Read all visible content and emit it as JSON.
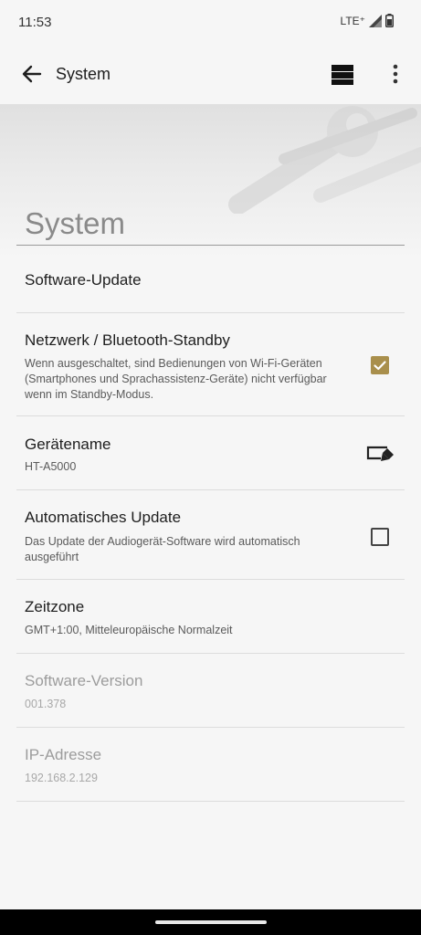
{
  "status_bar": {
    "time": "11:53",
    "network": "LTE⁺",
    "icons": [
      "signal-icon",
      "battery-icon"
    ]
  },
  "app_bar": {
    "title": "System",
    "icons": [
      "back-arrow-icon",
      "grid-view-icon",
      "more-vert-icon"
    ]
  },
  "hero": {
    "title": "System"
  },
  "settings": {
    "software_update": {
      "title": "Software-Update"
    },
    "network_standby": {
      "title": "Netzwerk / Bluetooth-Standby",
      "subtitle": "Wenn ausgeschaltet, sind Bedienungen von Wi-Fi-Geräten (Smartphones und Sprachassistenz-Geräte) nicht verfügbar wenn im Standby-Modus.",
      "checked": true
    },
    "device_name": {
      "title": "Gerätename",
      "value": "HT-A5000"
    },
    "auto_update": {
      "title": "Automatisches Update",
      "subtitle": "Das Update der Audiogerät-Software wird automatisch ausgeführt",
      "checked": false
    },
    "timezone": {
      "title": "Zeitzone",
      "value": "GMT+1:00, Mitteleuropäische Normalzeit"
    },
    "software_version": {
      "title": "Software-Version",
      "value": "001.378"
    },
    "ip_address": {
      "title": "IP-Adresse",
      "value": "192.168.2.129"
    }
  },
  "colors": {
    "accent_checkbox": "#a98f4c",
    "background": "#f6f6f6",
    "divider": "#dcdcdc"
  }
}
